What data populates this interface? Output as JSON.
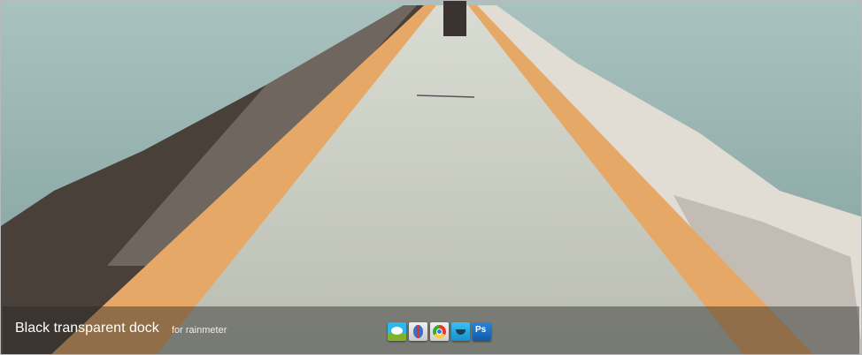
{
  "dock": {
    "title": "Black transparent dock",
    "subtitle": "for rainmeter",
    "icons": [
      {
        "name": "messages-icon",
        "color": "#2bb0e8"
      },
      {
        "name": "compass-icon",
        "color": "#dcdcdc"
      },
      {
        "name": "chrome-icon",
        "color": "#e8e8e8"
      },
      {
        "name": "twitter-icon",
        "color": "#1ea8e0"
      },
      {
        "name": "photoshop-icon",
        "label": "Ps",
        "color": "#1a6fc0"
      }
    ]
  }
}
